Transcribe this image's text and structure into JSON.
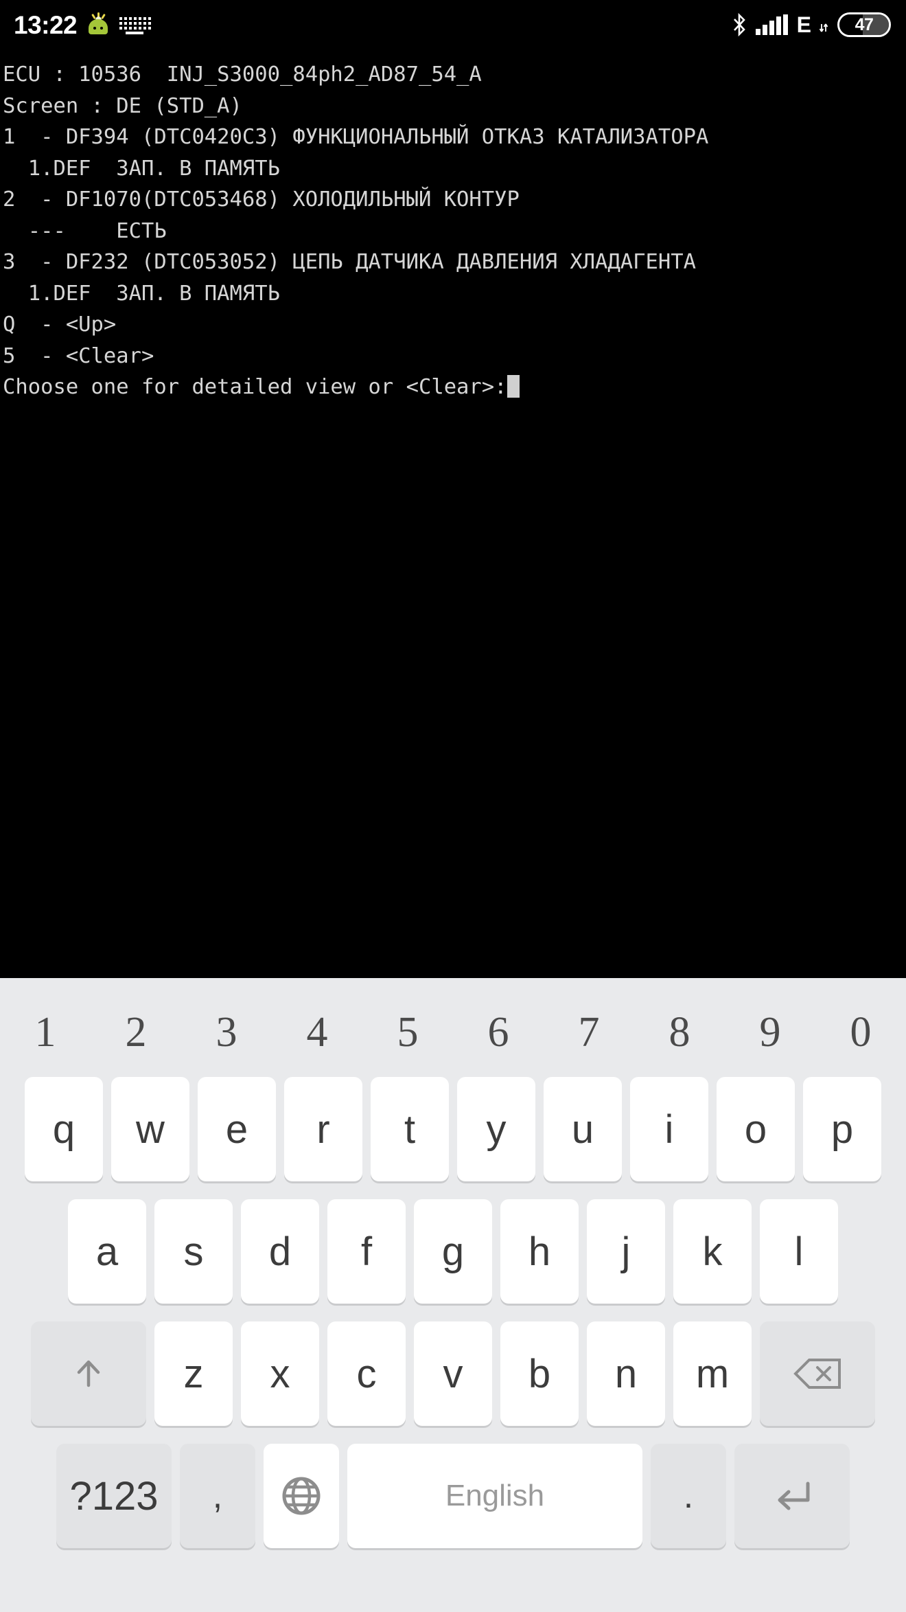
{
  "statusbar": {
    "time": "13:22",
    "app_icon": "android-robot-icon",
    "keyboard_icon": "keyboard-icon",
    "bluetooth_icon": "bluetooth-icon",
    "signal_icon": "cellular-signal-icon",
    "network_type": "E",
    "data_arrows_icon": "data-transfer-icon",
    "battery_level": "47",
    "battery_percent": 47,
    "colors": {
      "bar_bg": "#000000",
      "icon": "#ffffff",
      "android_green": "#a4c639"
    }
  },
  "terminal": {
    "bg_color": "#000000",
    "text_color": "#d6d6d6",
    "cursor_color": "#d0d0d0",
    "lines": [
      "ECU : 10536  INJ_S3000_84ph2_AD87_54_A",
      "Screen : DE (STD_A)",
      "1  - DF394 (DTC0420C3) ФУНКЦИОНАЛЬНЫЙ ОТКАЗ КАТАЛИЗАТОРА",
      "  1.DEF  ЗАП. В ПАМЯТЬ",
      "2  - DF1070(DTC053468) ХОЛОДИЛЬНЫЙ КОНТУР",
      "  ---    ЕСТЬ",
      "3  - DF232 (DTC053052) ЦЕПЬ ДАТЧИКА ДАВЛЕНИЯ ХЛАДАГЕНТА",
      "  1.DEF  ЗАП. В ПАМЯТЬ",
      "Q  - <Up>",
      "5  - <Clear>"
    ],
    "prompt": "Choose one for detailed view or <Clear>:",
    "input_value": ""
  },
  "keyboard": {
    "bg_color": "#e9eaec",
    "key_color": "#ffffff",
    "fn_key_color": "#e2e3e5",
    "label_color": "#3c3c3c",
    "number_row": [
      "1",
      "2",
      "3",
      "4",
      "5",
      "6",
      "7",
      "8",
      "9",
      "0"
    ],
    "row1": [
      "q",
      "w",
      "e",
      "r",
      "t",
      "y",
      "u",
      "i",
      "o",
      "p"
    ],
    "row2": [
      "a",
      "s",
      "d",
      "f",
      "g",
      "h",
      "j",
      "k",
      "l"
    ],
    "row3": [
      "z",
      "x",
      "c",
      "v",
      "b",
      "n",
      "m"
    ],
    "shift_label": "shift-icon",
    "backspace_label": "backspace-icon",
    "symbols_label": "?123",
    "comma_label": ",",
    "globe_label": "globe-icon",
    "space_label": "English",
    "period_label": ".",
    "enter_label": "enter-icon"
  }
}
